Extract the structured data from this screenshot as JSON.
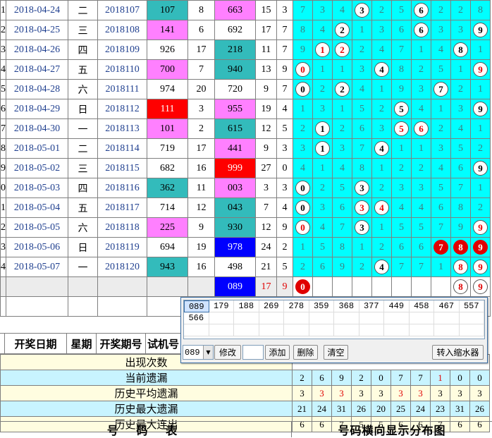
{
  "rows": [
    {
      "idx": "1",
      "date": "2018-04-24",
      "wk": "二",
      "num": "2018107",
      "a": "107",
      "b": "8",
      "c": "663",
      "sum": "15",
      "span": "3",
      "ca": "teal",
      "cc": "pink",
      "d": [
        {
          "t": "7"
        },
        {
          "t": "3"
        },
        {
          "t": "4"
        },
        {
          "t": "3",
          "b": "o"
        },
        {
          "t": "2"
        },
        {
          "t": "5"
        },
        {
          "t": "6",
          "b": "o"
        },
        {
          "t": "2"
        },
        {
          "t": "2"
        },
        {
          "t": "8"
        }
      ]
    },
    {
      "idx": "2",
      "date": "2018-04-25",
      "wk": "三",
      "num": "2018108",
      "a": "141",
      "b": "6",
      "c": "692",
      "sum": "17",
      "span": "7",
      "ca": "pink",
      "cc": "none",
      "d": [
        {
          "t": "8"
        },
        {
          "t": "4"
        },
        {
          "t": "2",
          "b": "o"
        },
        {
          "t": "1"
        },
        {
          "t": "3"
        },
        {
          "t": "6"
        },
        {
          "t": "6",
          "b": "o"
        },
        {
          "t": "3"
        },
        {
          "t": "3"
        },
        {
          "t": "9",
          "b": "o"
        }
      ]
    },
    {
      "idx": "3",
      "date": "2018-04-26",
      "wk": "四",
      "num": "2018109",
      "a": "926",
      "b": "17",
      "c": "218",
      "sum": "11",
      "span": "7",
      "ca": "none",
      "cc": "teal",
      "d": [
        {
          "t": "9"
        },
        {
          "t": "1",
          "b": "r"
        },
        {
          "t": "2",
          "b": "r"
        },
        {
          "t": "2"
        },
        {
          "t": "4"
        },
        {
          "t": "7"
        },
        {
          "t": "1"
        },
        {
          "t": "4"
        },
        {
          "t": "8",
          "b": "o"
        },
        {
          "t": "1"
        }
      ]
    },
    {
      "idx": "4",
      "date": "2018-04-27",
      "wk": "五",
      "num": "2018110",
      "a": "700",
      "b": "7",
      "c": "940",
      "sum": "13",
      "span": "9",
      "ca": "pink",
      "cc": "teal",
      "d": [
        {
          "t": "0",
          "b": "r"
        },
        {
          "t": "1"
        },
        {
          "t": "1"
        },
        {
          "t": "3"
        },
        {
          "t": "4",
          "b": "o"
        },
        {
          "t": "8"
        },
        {
          "t": "2"
        },
        {
          "t": "5"
        },
        {
          "t": "1"
        },
        {
          "t": "9",
          "b": "r"
        }
      ]
    },
    {
      "idx": "5",
      "date": "2018-04-28",
      "wk": "六",
      "num": "2018111",
      "a": "974",
      "b": "20",
      "c": "720",
      "sum": "9",
      "span": "7",
      "ca": "none",
      "cc": "none",
      "d": [
        {
          "t": "0",
          "b": "o"
        },
        {
          "t": "2"
        },
        {
          "t": "2",
          "b": "o"
        },
        {
          "t": "4"
        },
        {
          "t": "1"
        },
        {
          "t": "9"
        },
        {
          "t": "3"
        },
        {
          "t": "7",
          "b": "o"
        },
        {
          "t": "2"
        },
        {
          "t": "1"
        }
      ]
    },
    {
      "idx": "6",
      "date": "2018-04-29",
      "wk": "日",
      "num": "2018112",
      "a": "111",
      "b": "3",
      "c": "955",
      "sum": "19",
      "span": "4",
      "ca": "red",
      "cc": "pink",
      "d": [
        {
          "t": "1"
        },
        {
          "t": "3"
        },
        {
          "t": "1"
        },
        {
          "t": "5"
        },
        {
          "t": "2"
        },
        {
          "t": "5",
          "b": "o"
        },
        {
          "t": "4"
        },
        {
          "t": "1"
        },
        {
          "t": "3"
        },
        {
          "t": "9",
          "b": "o"
        }
      ]
    },
    {
      "idx": "7",
      "date": "2018-04-30",
      "wk": "一",
      "num": "2018113",
      "a": "101",
      "b": "2",
      "c": "615",
      "sum": "12",
      "span": "5",
      "ca": "pink",
      "cc": "teal",
      "d": [
        {
          "t": "2"
        },
        {
          "t": "1",
          "b": "o"
        },
        {
          "t": "2"
        },
        {
          "t": "6"
        },
        {
          "t": "3"
        },
        {
          "t": "5",
          "b": "r"
        },
        {
          "t": "6",
          "b": "r"
        },
        {
          "t": "2"
        },
        {
          "t": "4"
        },
        {
          "t": "1"
        }
      ]
    },
    {
      "idx": "8",
      "date": "2018-05-01",
      "wk": "二",
      "num": "2018114",
      "a": "719",
      "b": "17",
      "c": "441",
      "sum": "9",
      "span": "3",
      "ca": "none",
      "cc": "pink",
      "d": [
        {
          "t": "3"
        },
        {
          "t": "1",
          "b": "o"
        },
        {
          "t": "3"
        },
        {
          "t": "7"
        },
        {
          "t": "4",
          "b": "o"
        },
        {
          "t": "1"
        },
        {
          "t": "1"
        },
        {
          "t": "3"
        },
        {
          "t": "5"
        },
        {
          "t": "2"
        }
      ]
    },
    {
      "idx": "9",
      "date": "2018-05-02",
      "wk": "三",
      "num": "2018115",
      "a": "682",
      "b": "16",
      "c": "999",
      "sum": "27",
      "span": "0",
      "ca": "none",
      "cc": "red",
      "d": [
        {
          "t": "4"
        },
        {
          "t": "1"
        },
        {
          "t": "4"
        },
        {
          "t": "8"
        },
        {
          "t": "1"
        },
        {
          "t": "2"
        },
        {
          "t": "2"
        },
        {
          "t": "4"
        },
        {
          "t": "6"
        },
        {
          "t": "9",
          "b": "o"
        }
      ]
    },
    {
      "idx": "0",
      "date": "2018-05-03",
      "wk": "四",
      "num": "2018116",
      "a": "362",
      "b": "11",
      "c": "003",
      "sum": "3",
      "span": "3",
      "ca": "teal",
      "cc": "pink",
      "d": [
        {
          "t": "0",
          "b": "o"
        },
        {
          "t": "2"
        },
        {
          "t": "5"
        },
        {
          "t": "3",
          "b": "o"
        },
        {
          "t": "2"
        },
        {
          "t": "3"
        },
        {
          "t": "3"
        },
        {
          "t": "5"
        },
        {
          "t": "7"
        },
        {
          "t": "1"
        }
      ]
    },
    {
      "idx": "1",
      "date": "2018-05-04",
      "wk": "五",
      "num": "2018117",
      "a": "714",
      "b": "12",
      "c": "043",
      "sum": "7",
      "span": "4",
      "ca": "none",
      "cc": "teal",
      "d": [
        {
          "t": "0",
          "b": "o"
        },
        {
          "t": "3"
        },
        {
          "t": "6"
        },
        {
          "t": "3",
          "b": "r"
        },
        {
          "t": "4",
          "b": "r"
        },
        {
          "t": "4"
        },
        {
          "t": "4"
        },
        {
          "t": "6"
        },
        {
          "t": "8"
        },
        {
          "t": "2"
        }
      ]
    },
    {
      "idx": "2",
      "date": "2018-05-05",
      "wk": "六",
      "num": "2018118",
      "a": "225",
      "b": "9",
      "c": "930",
      "sum": "12",
      "span": "9",
      "ca": "pink",
      "cc": "teal",
      "d": [
        {
          "t": "0",
          "b": "r"
        },
        {
          "t": "4"
        },
        {
          "t": "7"
        },
        {
          "t": "3",
          "b": "o"
        },
        {
          "t": "1"
        },
        {
          "t": "5"
        },
        {
          "t": "5"
        },
        {
          "t": "7"
        },
        {
          "t": "9"
        },
        {
          "t": "9",
          "b": "r"
        }
      ]
    },
    {
      "idx": "3",
      "date": "2018-05-06",
      "wk": "日",
      "num": "2018119",
      "a": "694",
      "b": "19",
      "c": "978",
      "sum": "24",
      "span": "2",
      "ca": "none",
      "cc": "blue",
      "d": [
        {
          "t": "1"
        },
        {
          "t": "5"
        },
        {
          "t": "8"
        },
        {
          "t": "1"
        },
        {
          "t": "2"
        },
        {
          "t": "6"
        },
        {
          "t": "6"
        },
        {
          "t": "7",
          "b": "f"
        },
        {
          "t": "8",
          "b": "f"
        },
        {
          "t": "9",
          "b": "f"
        }
      ]
    },
    {
      "idx": "4",
      "date": "2018-05-07",
      "wk": "一",
      "num": "2018120",
      "a": "943",
      "b": "16",
      "c": "498",
      "sum": "21",
      "span": "5",
      "ca": "teal",
      "cc": "none",
      "d": [
        {
          "t": "2"
        },
        {
          "t": "6"
        },
        {
          "t": "9"
        },
        {
          "t": "2"
        },
        {
          "t": "4",
          "b": "o"
        },
        {
          "t": "7"
        },
        {
          "t": "7"
        },
        {
          "t": "1"
        },
        {
          "t": "8",
          "b": "r"
        },
        {
          "t": "9",
          "b": "r"
        }
      ]
    }
  ],
  "pending": {
    "c": "089",
    "sum": "17",
    "span": "9",
    "d": [
      {
        "t": "0",
        "b": "f"
      },
      {
        "t": ""
      },
      {
        "t": ""
      },
      {
        "t": ""
      },
      {
        "t": ""
      },
      {
        "t": ""
      },
      {
        "t": ""
      },
      {
        "t": ""
      },
      {
        "t": "8",
        "b": "r"
      },
      {
        "t": "9",
        "b": "r"
      }
    ]
  },
  "headers": {
    "date": "开奖日期",
    "week": "星期",
    "issue": "开奖期号",
    "trial": "试机号"
  },
  "stats": {
    "appear_label": "出现次数",
    "rows": [
      {
        "label": "当前遗漏",
        "vals": [
          "2",
          "6",
          "9",
          "2",
          "0",
          "7",
          "7",
          "1",
          "0",
          "0"
        ],
        "red": [
          7
        ]
      },
      {
        "label": "历史平均遗漏",
        "vals": [
          "3",
          "3",
          "3",
          "3",
          "3",
          "3",
          "3",
          "3",
          "3",
          "3"
        ],
        "red": [
          1,
          2,
          5,
          6
        ]
      },
      {
        "label": "历史最大遗漏",
        "vals": [
          "21",
          "24",
          "31",
          "26",
          "20",
          "25",
          "24",
          "23",
          "31",
          "26"
        ],
        "red": []
      },
      {
        "label": "历史最大连出",
        "vals": [
          "6",
          "6",
          "7",
          "5",
          "5",
          "6",
          "6",
          "7",
          "6",
          "6"
        ],
        "red": []
      }
    ]
  },
  "footer": {
    "left": "号 码 表",
    "right": "号码横向显示分布图"
  },
  "dialog": {
    "numbers": [
      "089",
      "179",
      "188",
      "269",
      "278",
      "359",
      "368",
      "377",
      "449",
      "458",
      "467",
      "557",
      "566"
    ],
    "combo_value": "089",
    "modify": "修改",
    "add": "添加",
    "delete": "删除",
    "clear": "清空",
    "transfer": "转入缩水器"
  },
  "colors": {
    "teal": "#33bbbb",
    "pink": "#ff80ff",
    "red": "#ff0000",
    "blue": "#0000ff",
    "cyan": "#00ffff",
    "highlight": "#e00000"
  }
}
